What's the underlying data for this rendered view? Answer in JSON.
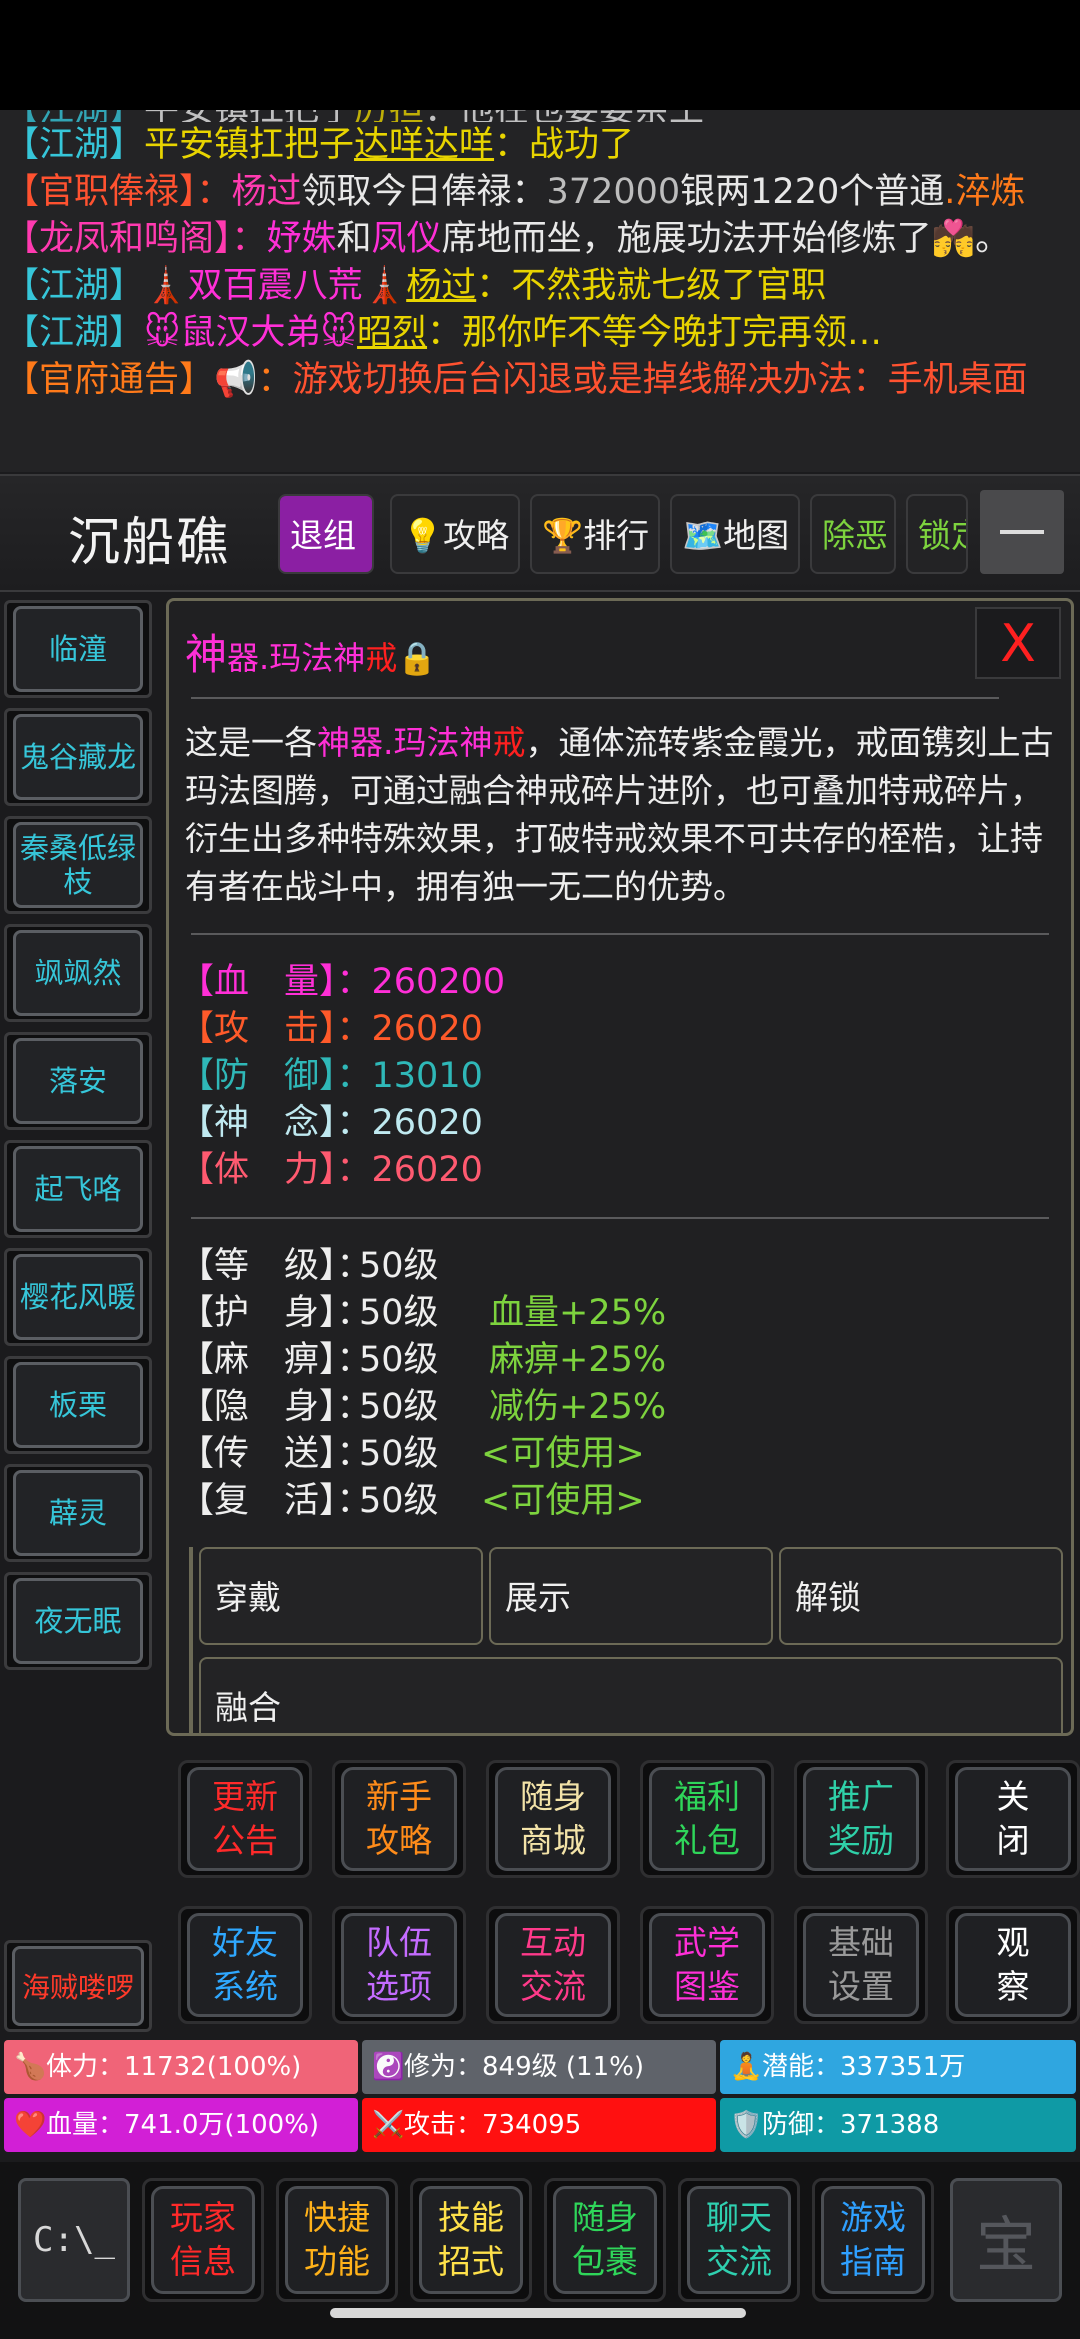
{
  "chat": [
    {
      "segs": [
        {
          "t": "【江湖】",
          "c": "c-cyan"
        },
        {
          "t": "平安镇扛把子"
        },
        {
          "t": "厉担",
          "c": "c-yellow u"
        },
        {
          "t": "：他在也要要亲王"
        }
      ],
      "partial": true
    },
    {
      "segs": [
        {
          "t": "【江湖】",
          "c": "c-cyan"
        },
        {
          "t": "平安镇扛把子",
          "c": "c-yellow"
        },
        {
          "t": "达咩达咩",
          "c": "c-yellow u"
        },
        {
          "t": "：战功了",
          "c": "c-yellow"
        }
      ]
    },
    {
      "segs": [
        {
          "t": "【官职俸禄】：",
          "c": "c-red"
        },
        {
          "t": "杨过",
          "c": "c-pink"
        },
        {
          "t": "领取今日俸禄："
        },
        {
          "t": "372000",
          "c": "c-grey"
        },
        {
          "t": "银两1220个普通"
        },
        {
          "t": ".淬炼",
          "c": "c-orange"
        }
      ]
    },
    {
      "segs": [
        {
          "t": "【龙凤和鸣阁】：",
          "c": "c-pink"
        },
        {
          "t": "妤姝",
          "c": "c-magenta"
        },
        {
          "t": "和"
        },
        {
          "t": "凤仪",
          "c": "c-magenta"
        },
        {
          "t": "席地而坐，施展功法开始修炼了💏。"
        }
      ]
    },
    {
      "segs": [
        {
          "t": "【江湖】",
          "c": "c-cyan"
        },
        {
          "t": "🗼双百震八荒🗼",
          "c": "c-magenta"
        },
        {
          "t": "杨过",
          "c": "c-yellow u"
        },
        {
          "t": "：不然我就七级了官职",
          "c": "c-yellow"
        }
      ]
    },
    {
      "segs": [
        {
          "t": "【江湖】",
          "c": "c-cyan"
        },
        {
          "t": "🐭鼠汉大弟🐭",
          "c": "c-magenta"
        },
        {
          "t": "昭烈",
          "c": "c-yellow u"
        },
        {
          "t": "：那你咋不等今晚打完再领…",
          "c": "c-yellow"
        }
      ]
    },
    {
      "segs": [
        {
          "t": "【官府通告】📢：",
          "c": "c-orange"
        },
        {
          "t": "游戏切换后台闪退或是掉线解决办法：手机桌面",
          "c": "c-red"
        }
      ]
    }
  ],
  "location": {
    "title": "沉船礁",
    "buttons": [
      {
        "label": "退组"
      },
      {
        "label": "💡攻略"
      },
      {
        "label": "🏆排行"
      },
      {
        "label": "🗺️地图"
      },
      {
        "label": "除恶"
      },
      {
        "label": "锁定"
      }
    ]
  },
  "names": [
    "临潼",
    "鬼谷藏龙",
    "秦桑低绿枝",
    "飒飒然",
    "落安",
    "起飞咯",
    "樱花风暖",
    "板栗",
    "薜灵",
    "夜无眠"
  ],
  "pirate": "海贼喽啰",
  "item": {
    "title_a": "神",
    "title_b": "器.玛法神",
    "title_c": "戒",
    "lock": "🔒",
    "close": "X",
    "desc_pre": "这是一各",
    "desc_name_a": "神器.玛法神",
    "desc_name_b": "戒",
    "desc_post": "，通体流转紫金霞光，戒面镌刻上古玛法图腾，可通过融合神戒碎片进阶，也可叠加特戒碎片，衍生出多种特殊效果，打破特戒效果不可共存的桎梏，让持有者在战斗中，拥有独一无二的优势。",
    "stats": [
      {
        "label": "【血　量】：",
        "value": "260200",
        "color": "#ff2fd7"
      },
      {
        "label": "【攻　击】：",
        "value": "26020",
        "color": "#ff5a2a"
      },
      {
        "label": "【防　御】：",
        "value": "13010",
        "color": "#2fb8b8"
      },
      {
        "label": "【神　念】：",
        "value": "26020",
        "color": "#bfe9f0"
      },
      {
        "label": "【体　力】：",
        "value": "26020",
        "color": "#ff5a70"
      }
    ],
    "skills": [
      {
        "label": "【等　级】：",
        "level": "50级",
        "effect": ""
      },
      {
        "label": "【护　身】：",
        "level": "50级",
        "effect": "血量+25%"
      },
      {
        "label": "【麻　痹】：",
        "level": "50级",
        "effect": "麻痹+25%"
      },
      {
        "label": "【隐　身】：",
        "level": "50级",
        "effect": "减伤+25%"
      },
      {
        "label": "【传　送】：",
        "level": "50级",
        "effect": "<可使用>"
      },
      {
        "label": "【复　活】：",
        "level": "50级",
        "effect": "<可使用>"
      }
    ],
    "actions": [
      "穿戴",
      "展示",
      "解锁",
      "融合"
    ]
  },
  "functions": [
    {
      "label": "更新公告",
      "color": "#ff2a2a"
    },
    {
      "label": "新手攻略",
      "color": "#ff8c1a"
    },
    {
      "label": "随身商城",
      "color": "#f3e3a8"
    },
    {
      "label": "福利礼包",
      "color": "#2fd65a"
    },
    {
      "label": "推广奖励",
      "color": "#2fd0a8"
    },
    {
      "label": "关闭",
      "color": "#ffffff"
    },
    {
      "label": "好友系统",
      "color": "#2fa8ff"
    },
    {
      "label": "队伍选项",
      "color": "#c46bff"
    },
    {
      "label": "互动交流",
      "color": "#ff3a8a"
    },
    {
      "label": "武学图鉴",
      "color": "#ff2fd7"
    },
    {
      "label": "基础设置",
      "color": "#9a9a9a"
    },
    {
      "label": "观察",
      "color": "#ffffff"
    }
  ],
  "status": {
    "stamina": {
      "icon": "🍗",
      "text": "体力：11732(100%)",
      "color": "#f06478"
    },
    "cultivation": {
      "icon": "☯️",
      "text": "修为：849级 (11%)",
      "color": "#5f636a"
    },
    "potential": {
      "icon": "🧘",
      "text": "潜能：337351万",
      "color": "#2fa6e0"
    },
    "hp": {
      "icon": "❤️",
      "text": "血量：741.0万(100%)",
      "color": "#d21fd6"
    },
    "attack": {
      "icon": "⚔️",
      "text": "攻击：734095",
      "color": "#ff1010"
    },
    "defense": {
      "icon": "🛡️",
      "text": "防御：371388",
      "color": "#0f9aa5"
    }
  },
  "nav": [
    {
      "label": "玩家信息",
      "color": "#ff2a2a"
    },
    {
      "label": "快捷功能",
      "color": "#ffb21a"
    },
    {
      "label": "技能招式",
      "color": "#ffe14a"
    },
    {
      "label": "随身包裹",
      "color": "#2fd65a"
    },
    {
      "label": "聊天交流",
      "color": "#2fd0b0"
    },
    {
      "label": "游戏指南",
      "color": "#2fa0ff"
    }
  ],
  "nav_left_icon": "C:\\_",
  "nav_right_icon": "宝"
}
